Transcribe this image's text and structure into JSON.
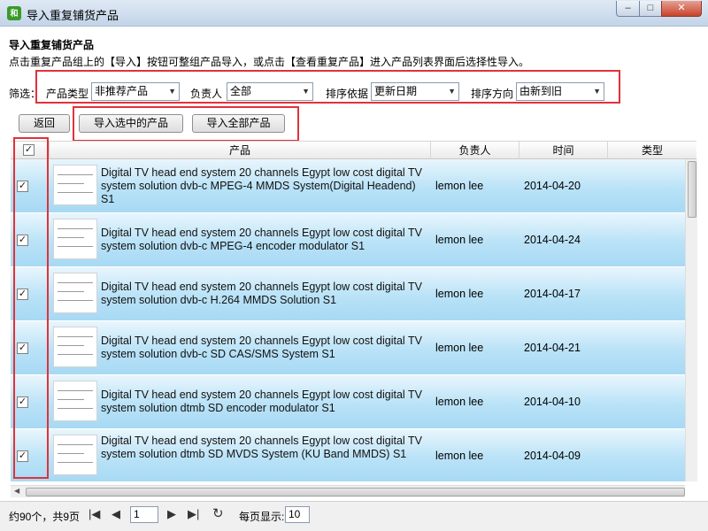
{
  "window": {
    "title": "导入重复铺货产品",
    "icon_label": "和",
    "min_glyph": "–",
    "max_glyph": "□",
    "close_glyph": "✕"
  },
  "heading": "导入重复铺货产品",
  "description": "点击重复产品组上的【导入】按钮可整组产品导入，或点击【查看重复产品】进入产品列表界面后选择性导入。",
  "filters": {
    "label": "筛选：",
    "product_type_label": "产品类型",
    "product_type_value": "非推荐产品",
    "owner_label": "负责人",
    "owner_value": "全部",
    "sort_by_label": "排序依据",
    "sort_by_value": "更新日期",
    "sort_dir_label": "排序方向",
    "sort_dir_value": "由新到旧",
    "dropdown_glyph": "▼"
  },
  "buttons": {
    "back": "返回",
    "import_selected": "导入选中的产品",
    "import_all": "导入全部产品"
  },
  "table": {
    "columns": [
      "产品",
      "负责人",
      "时间",
      "类型"
    ],
    "header_checked": true,
    "rows": [
      {
        "checked": true,
        "name": "Digital TV head end system 20 channels Egypt low cost digital TV system solution dvb-c MPEG-4 MMDS System(Digital Headend) S1",
        "owner": "lemon lee",
        "date": "2014-04-20"
      },
      {
        "checked": true,
        "name": "Digital TV head end system 20 channels Egypt low cost digital TV system solution dvb-c MPEG-4 encoder modulator S1",
        "owner": "lemon lee",
        "date": "2014-04-24"
      },
      {
        "checked": true,
        "name": "Digital TV head end system 20 channels Egypt low cost digital TV system solution dvb-c H.264 MMDS Solution S1",
        "owner": "lemon lee",
        "date": "2014-04-17"
      },
      {
        "checked": true,
        "name": "Digital TV head end system 20 channels Egypt low cost digital TV system solution dvb-c SD CAS/SMS System S1",
        "owner": "lemon lee",
        "date": "2014-04-21"
      },
      {
        "checked": true,
        "name": "Digital TV head end system 20 channels Egypt low cost digital TV system solution dtmb SD encoder modulator S1",
        "owner": "lemon lee",
        "date": "2014-04-10"
      },
      {
        "checked": true,
        "name": "Digital TV head end system 20 channels Egypt low cost digital TV system solution dtmb SD MVDS System (KU Band MMDS) S1",
        "owner": "lemon lee",
        "date": "2014-04-09"
      }
    ]
  },
  "pager": {
    "summary": "约90个，共9页",
    "current_page": "1",
    "per_page_label": "每页显示:",
    "per_page_value": "10",
    "first_glyph": "|◀",
    "prev_glyph": "◀",
    "next_glyph": "▶",
    "last_glyph": "▶|",
    "refresh_glyph": "↻"
  },
  "colors": {
    "highlight": "#e0323a",
    "row_gradient_top": "#e9f6fd",
    "row_gradient_bottom": "#a7d9f4"
  }
}
